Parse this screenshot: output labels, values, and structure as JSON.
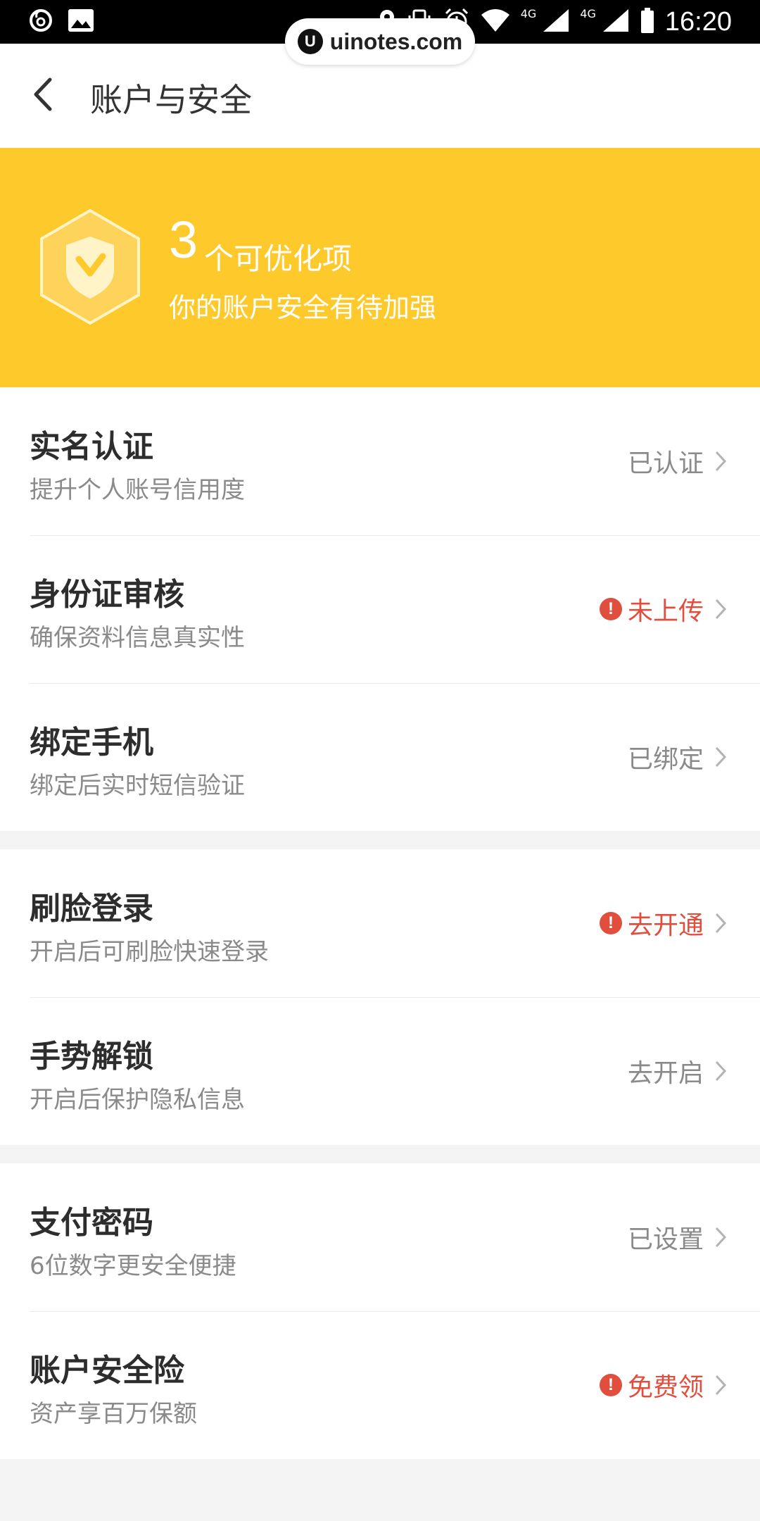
{
  "status_bar": {
    "time": "16:20",
    "signal_label_1": "4G",
    "signal_label_2": "4G"
  },
  "watermark": {
    "logo": "U",
    "text": "uinotes.com"
  },
  "header": {
    "title": "账户与安全",
    "back_icon": "chevron-left-icon"
  },
  "banner": {
    "count": "3",
    "count_label": "个可优化项",
    "subtitle": "你的账户安全有待加强",
    "shield_icon": "shield-check-icon",
    "background_color": "#fdc92b"
  },
  "groups": [
    {
      "items": [
        {
          "title": "实名认证",
          "subtitle": "提升个人账号信用度",
          "status": "已认证",
          "alert": false
        },
        {
          "title": "身份证审核",
          "subtitle": "确保资料信息真实性",
          "status": "未上传",
          "alert": true
        },
        {
          "title": "绑定手机",
          "subtitle": "绑定后实时短信验证",
          "status": "已绑定",
          "alert": false
        }
      ]
    },
    {
      "items": [
        {
          "title": "刷脸登录",
          "subtitle": "开启后可刷脸快速登录",
          "status": "去开通",
          "alert": true
        },
        {
          "title": "手势解锁",
          "subtitle": "开启后保护隐私信息",
          "status": "去开启",
          "alert": false
        }
      ]
    },
    {
      "items": [
        {
          "title": "支付密码",
          "subtitle": "6位数字更安全便捷",
          "status": "已设置",
          "alert": false
        },
        {
          "title": "账户安全险",
          "subtitle": "资产享百万保额",
          "status": "免费领",
          "alert": true
        }
      ]
    }
  ],
  "colors": {
    "alert": "#e04f3d",
    "muted": "#8a8a8a",
    "accent": "#fdc92b"
  },
  "alert_icon_glyph": "!"
}
